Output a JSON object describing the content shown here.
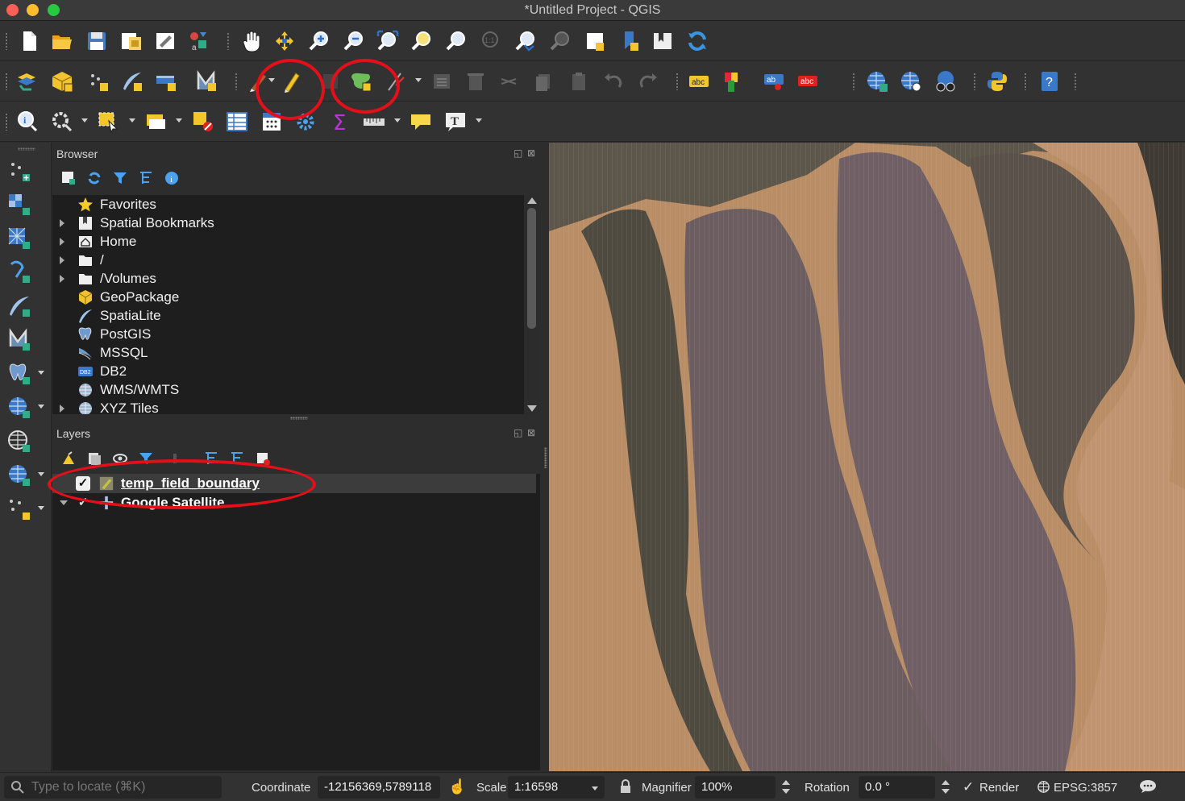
{
  "window": {
    "title": "*Untitled Project - QGIS"
  },
  "colors": {
    "annotation_circle": "#e3101a",
    "background": "#2d2d2d",
    "tree_background": "#1e1e1e",
    "selected_row": "#3c3c3c"
  },
  "toolbars": {
    "row1": [
      "new-project-icon",
      "open-project-icon",
      "save-project-icon",
      "save-as-icon",
      "print-layout-icon",
      "style-manager-icon",
      "pan-icon",
      "pan-to-selection-icon",
      "zoom-in-icon",
      "zoom-out-icon",
      "zoom-full-icon",
      "zoom-to-selection-icon",
      "zoom-to-layer-icon",
      "zoom-native-icon",
      "zoom-last-icon",
      "zoom-next-icon",
      "new-map-view-icon",
      "new-bookmark-icon",
      "show-bookmarks-icon",
      "refresh-icon"
    ],
    "row2": [
      "data-source-manager-icon",
      "new-geopackage-layer-icon",
      "new-temporary-layer-icon",
      "new-spatialite-layer-icon",
      "new-virtual-layer-icon",
      "digitize-icon",
      "current-edits-icon",
      "toggle-editing-icon",
      "save-edits-icon",
      "add-polygon-feature-icon",
      "vertex-tool-icon",
      "modify-attributes-icon",
      "delete-selected-icon",
      "cut-features-icon",
      "copy-features-icon",
      "paste-features-icon",
      "undo-icon",
      "redo-icon",
      "label-toolbar-icon",
      "diagram-icon",
      "pin-labels-icon",
      "highlight-labels-icon",
      "add-wms-layer-icon",
      "add-wcs-layer-icon",
      "metasearch-icon",
      "python-console-icon",
      "help-icon"
    ],
    "row3": [
      "identify-icon",
      "select-features-icon",
      "select-by-area-icon",
      "open-attribute-table-icon",
      "deselect-all-icon",
      "attribute-table-icon",
      "field-calculator-icon",
      "processing-toolbox-icon",
      "statistical-summary-icon",
      "measure-line-icon",
      "map-tips-icon",
      "text-annotation-icon"
    ]
  },
  "left_toolbar": [
    "add-point-layer-icon",
    "add-raster-layer-icon",
    "add-mesh-layer-icon",
    "add-delimited-text-icon",
    "add-spatialite-layer-icon",
    "add-virtual-layer-icon",
    "add-postgis-layer-icon",
    "add-wms-icon",
    "add-wfs-icon",
    "add-xyz-icon",
    "add-vector-tile-icon"
  ],
  "browser": {
    "title": "Browser",
    "items": [
      {
        "label": "Favorites",
        "icon": "star-icon",
        "expandable": false
      },
      {
        "label": "Spatial Bookmarks",
        "icon": "bookmark-icon",
        "expandable": true
      },
      {
        "label": "Home",
        "icon": "home-icon",
        "expandable": true
      },
      {
        "label": "/",
        "icon": "folder-icon",
        "expandable": true
      },
      {
        "label": "/Volumes",
        "icon": "folder-icon",
        "expandable": true
      },
      {
        "label": "GeoPackage",
        "icon": "geopackage-icon",
        "expandable": false
      },
      {
        "label": "SpatiaLite",
        "icon": "spatialite-icon",
        "expandable": false
      },
      {
        "label": "PostGIS",
        "icon": "postgis-icon",
        "expandable": false
      },
      {
        "label": "MSSQL",
        "icon": "mssql-icon",
        "expandable": false
      },
      {
        "label": "DB2",
        "icon": "db2-icon",
        "expandable": false
      },
      {
        "label": "WMS/WMTS",
        "icon": "wms-icon",
        "expandable": false
      },
      {
        "label": "XYZ Tiles",
        "icon": "xyz-icon",
        "expandable": true
      }
    ]
  },
  "layers": {
    "title": "Layers",
    "items": [
      {
        "name": "temp_field_boundary",
        "checked": true,
        "selected": true
      },
      {
        "name": "Google Satellite",
        "checked": true,
        "selected": false
      }
    ]
  },
  "statusbar": {
    "locator_placeholder": "Type to locate (⌘K)",
    "coordinate_label": "Coordinate",
    "coordinate_value": "-12156369,5789118",
    "scale_label": "Scale",
    "scale_value": "1:16598",
    "magnifier_label": "Magnifier",
    "magnifier_value": "100%",
    "rotation_label": "Rotation",
    "rotation_value": "0.0 °",
    "render_label": "Render",
    "render_check": "✓",
    "crs_value": "EPSG:3857"
  }
}
